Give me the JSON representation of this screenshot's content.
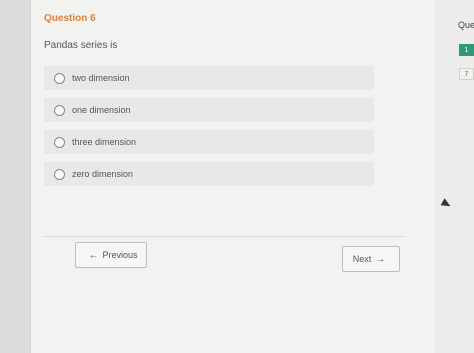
{
  "quiz": {
    "question_title": "Question 6",
    "question_text": "Pandas series is",
    "options": [
      {
        "label": "two dimension"
      },
      {
        "label": "one dimension"
      },
      {
        "label": "three dimension"
      },
      {
        "label": "zero dimension"
      }
    ],
    "prev_label": "Previous",
    "next_label": "Next"
  },
  "sidebar": {
    "title": "Que",
    "badge_number": "1",
    "number": "7"
  },
  "icons": {
    "prev": "arrow-left-icon",
    "next": "arrow-right-icon",
    "cursor": "mouse-cursor-icon",
    "radio": "radio-icon"
  },
  "colors": {
    "title": "#d9823b",
    "badge": "#2f9a7a"
  }
}
